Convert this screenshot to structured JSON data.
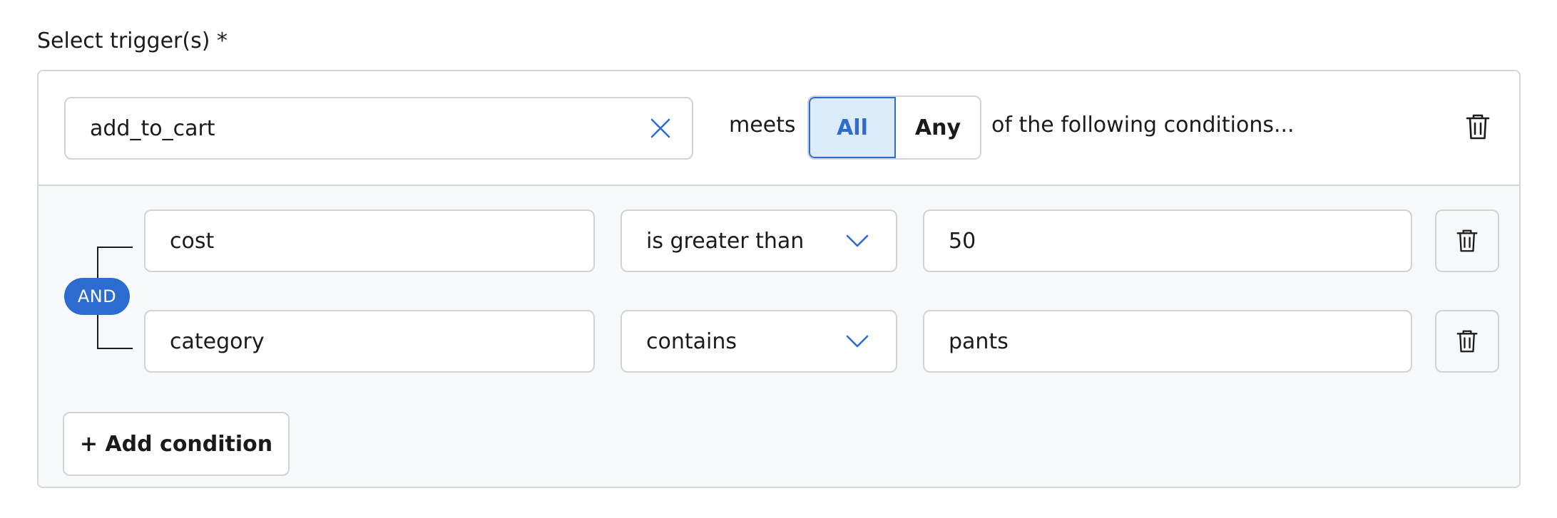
{
  "section": {
    "label": "Select trigger(s) *"
  },
  "trigger": {
    "value": "add_to_cart",
    "meets_text": "meets",
    "match_options": [
      {
        "label": "All",
        "selected": true
      },
      {
        "label": "Any",
        "selected": false
      }
    ],
    "following_text": "of the following conditions..."
  },
  "logic": {
    "operator": "AND"
  },
  "conditions": [
    {
      "field": "cost",
      "operator": "is greater than",
      "value": "50"
    },
    {
      "field": "category",
      "operator": "contains",
      "value": "pants"
    }
  ],
  "actions": {
    "add_condition_label": "+ Add condition"
  },
  "icons": {
    "clear": "close-icon",
    "delete": "trash-icon",
    "dropdown": "chevron-down-icon"
  },
  "colors": {
    "accent": "#2c6bd0",
    "selected_bg": "#dcebfa",
    "border": "#cfd3d9",
    "body_bg": "#f6f8fa"
  }
}
